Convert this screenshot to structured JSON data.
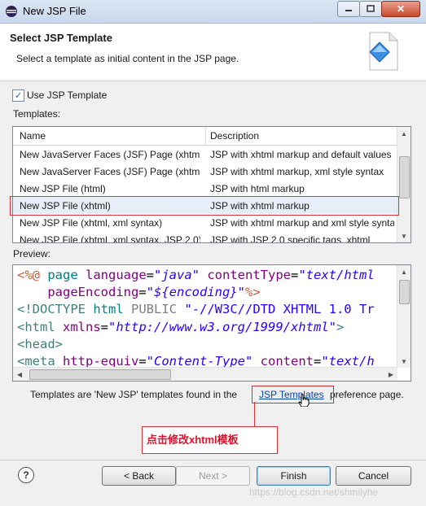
{
  "window": {
    "title": "New JSP File",
    "controls": {
      "minimize": "minimize",
      "maximize": "maximize",
      "close": "✕"
    }
  },
  "header": {
    "title": "Select JSP Template",
    "description": "Select a template as initial content in the JSP page."
  },
  "checkbox": {
    "label": "Use JSP Template",
    "checked": true,
    "mark": "✓"
  },
  "templates": {
    "label": "Templates:",
    "columns": [
      "Name",
      "Description"
    ],
    "rows": [
      {
        "name": "New JavaServer Faces (JSF) Page (xhtml)",
        "description": "JSP with xhtml markup and default values"
      },
      {
        "name": "New JavaServer Faces (JSF) Page (xhtml, xml syntax)",
        "description": "JSP with xhtml markup, xml style syntax"
      },
      {
        "name": "New JSP File (html)",
        "description": "JSP with html markup"
      },
      {
        "name": "New JSP File (xhtml)",
        "description": "JSP with xhtml markup"
      },
      {
        "name": "New JSP File (xhtml, xml syntax)",
        "description": "JSP with xhtml markup and xml style syntax"
      },
      {
        "name": "New JSP File (xhtml, xml syntax, JSP 2.0)",
        "description": "JSP with JSP 2.0 specific tags, xhtml"
      }
    ],
    "selected_index": 3
  },
  "preview": {
    "label": "Preview:",
    "line1": {
      "open": "<%@",
      "kw": " page ",
      "a1": "language",
      "eq1": "=",
      "v1": "\"java\"",
      "a2": " contentType",
      "eq2": "=",
      "v2": "\"text/html"
    },
    "line2": {
      "a": "    pageEncoding",
      "eq": "=",
      "v": "\"${encoding}\"",
      "close": "%>"
    },
    "line3": {
      "open": "<!DOCTYPE",
      "kw": " html ",
      "pub": "PUBLIC",
      "v": " \"-//W3C//DTD XHTML 1.0 Tr"
    },
    "line4": {
      "open": "<html",
      "a": " xmlns",
      "eq": "=",
      "v": "\"http://www.w3.org/1999/xhtml\"",
      "close": ">"
    },
    "line5": {
      "text": "<head>"
    },
    "line6": {
      "open": "<meta",
      "a1": " http-equiv",
      "eq1": "=",
      "v1": "\"Content-Type\"",
      "a2": " content",
      "eq2": "=",
      "v2": "\"text/h"
    }
  },
  "link_line": {
    "prefix": "Templates are 'New JSP' templates found in the",
    "link": "JSP Templates",
    "suffix": "preference page."
  },
  "annotation": {
    "text": "点击修改xhtml模板"
  },
  "buttons": {
    "help": "?",
    "back": "< Back",
    "next": "Next >",
    "finish": "Finish",
    "cancel": "Cancel"
  },
  "watermark": "https://blog.csdn.net/shmilyhe",
  "colors": {
    "highlight_red": "#d9323a",
    "link_blue": "#0645ad",
    "annotation_red": "#e0102a"
  }
}
